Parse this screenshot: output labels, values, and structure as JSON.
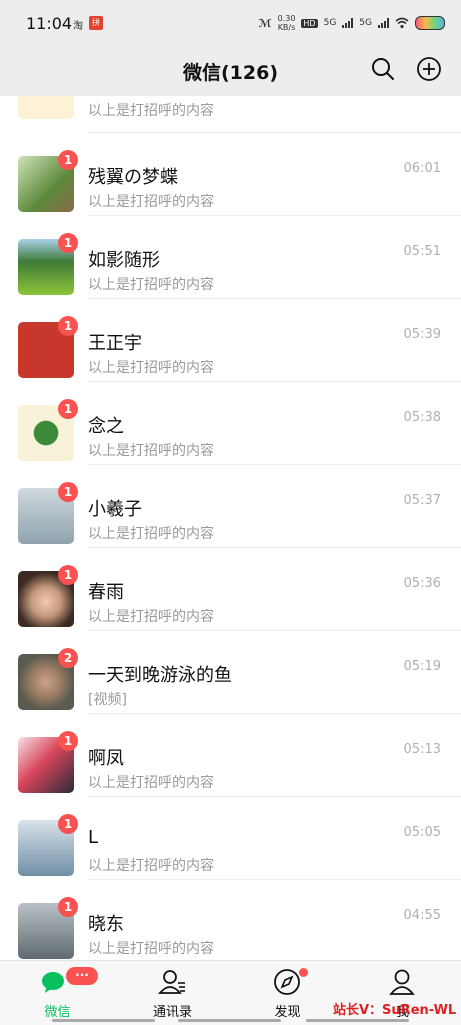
{
  "status_bar": {
    "time": "11:04",
    "taobao": "淘",
    "app_icon": "拼",
    "speed_value": "0.30",
    "speed_unit": "KB/s",
    "hd": "HD",
    "net1": "5G",
    "net2": "5G"
  },
  "header": {
    "title": "微信(126)"
  },
  "chats": [
    {
      "name": "",
      "preview": "以上是打招呼的内容",
      "time": "",
      "badge": "",
      "avatar_color": "#f2c24a"
    },
    {
      "name": "残翼の梦蝶",
      "preview": "以上是打招呼的内容",
      "time": "06:01",
      "badge": "1",
      "avatar_color": "#5d8a3c"
    },
    {
      "name": "如影随形",
      "preview": "以上是打招呼的内容",
      "time": "05:51",
      "badge": "1",
      "avatar_color": "#6fae3a"
    },
    {
      "name": "王正宇",
      "preview": "以上是打招呼的内容",
      "time": "05:39",
      "badge": "1",
      "avatar_color": "#c8372b"
    },
    {
      "name": "念之",
      "preview": "以上是打招呼的内容",
      "time": "05:38",
      "badge": "1",
      "avatar_color": "#3b8a3a"
    },
    {
      "name": "小羲子",
      "preview": "以上是打招呼的内容",
      "time": "05:37",
      "badge": "1",
      "avatar_color": "#9fb3bd"
    },
    {
      "name": "春雨",
      "preview": "以上是打招呼的内容",
      "time": "05:36",
      "badge": "1",
      "avatar_color": "#c79a7e"
    },
    {
      "name": "一天到晚游泳的鱼",
      "preview": "[视频]",
      "time": "05:19",
      "badge": "2",
      "avatar_color": "#8e8a7a"
    },
    {
      "name": "啊凤",
      "preview": "以上是打招呼的内容",
      "time": "05:13",
      "badge": "1",
      "avatar_color": "#d8465a"
    },
    {
      "name": "L",
      "preview": "以上是打招呼的内容",
      "time": "05:05",
      "badge": "1",
      "avatar_color": "#6f8fa6"
    },
    {
      "name": "晓东",
      "preview": "以上是打招呼的内容",
      "time": "04:55",
      "badge": "1",
      "avatar_color": "#7f8c8d"
    }
  ],
  "tabs": [
    {
      "label": "微信",
      "icon": "chat-bubbles-icon",
      "badge": "···"
    },
    {
      "label": "通讯录",
      "icon": "contacts-icon"
    },
    {
      "label": "发现",
      "icon": "compass-icon"
    },
    {
      "label": "我",
      "icon": "person-icon"
    }
  ],
  "watermark": "站长V：SuRen-WL",
  "colors": {
    "accent": "#07c160",
    "badge": "#fa5151",
    "header_bg": "#ededed"
  }
}
